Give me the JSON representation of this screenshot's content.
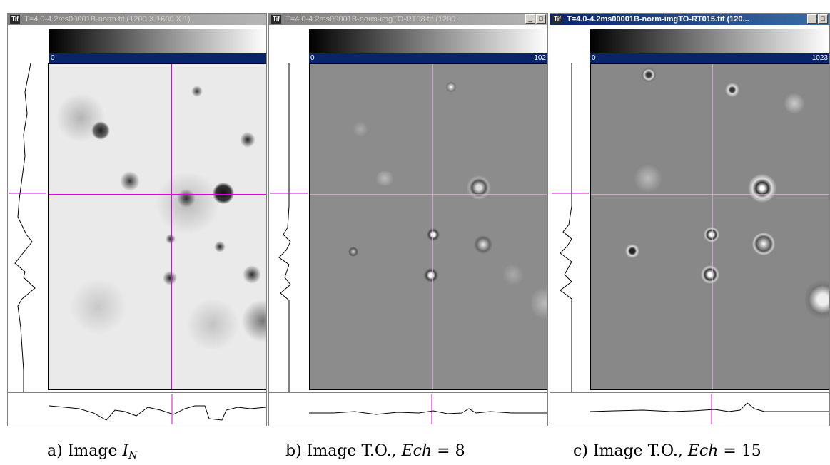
{
  "windows": [
    {
      "title": "T=4.0-4.2ms00001B-norm.tif (1200 X 1600 X 1)",
      "lut_min": "0",
      "lut_max": "",
      "active": false
    },
    {
      "title": "T=4.0-4.2ms00001B-norm-imgTO-RT08.tif (1200...",
      "lut_min": "0",
      "lut_max": "102",
      "active": false
    },
    {
      "title": "T=4.0-4.2ms00001B-norm-imgTO-RT015.tif (120...",
      "lut_min": "0",
      "lut_max": "1023",
      "active": true
    }
  ],
  "window_controls": {
    "minimize": "_",
    "maximize": "□"
  },
  "icon": "tiff-icon",
  "captions": {
    "a_prefix": "a) Image ",
    "a_var": "I",
    "a_sub": "N",
    "b_prefix": "b) Image T.O., ",
    "b_var": "Ech",
    "b_eq": " = 8",
    "c_prefix": "c) Image T.O., ",
    "c_var": "Ech",
    "c_eq": " = 15"
  },
  "colors": {
    "titlebar_active": "#0a246a",
    "crosshair": "#e000e0",
    "lut_bar": "#0a246a"
  }
}
